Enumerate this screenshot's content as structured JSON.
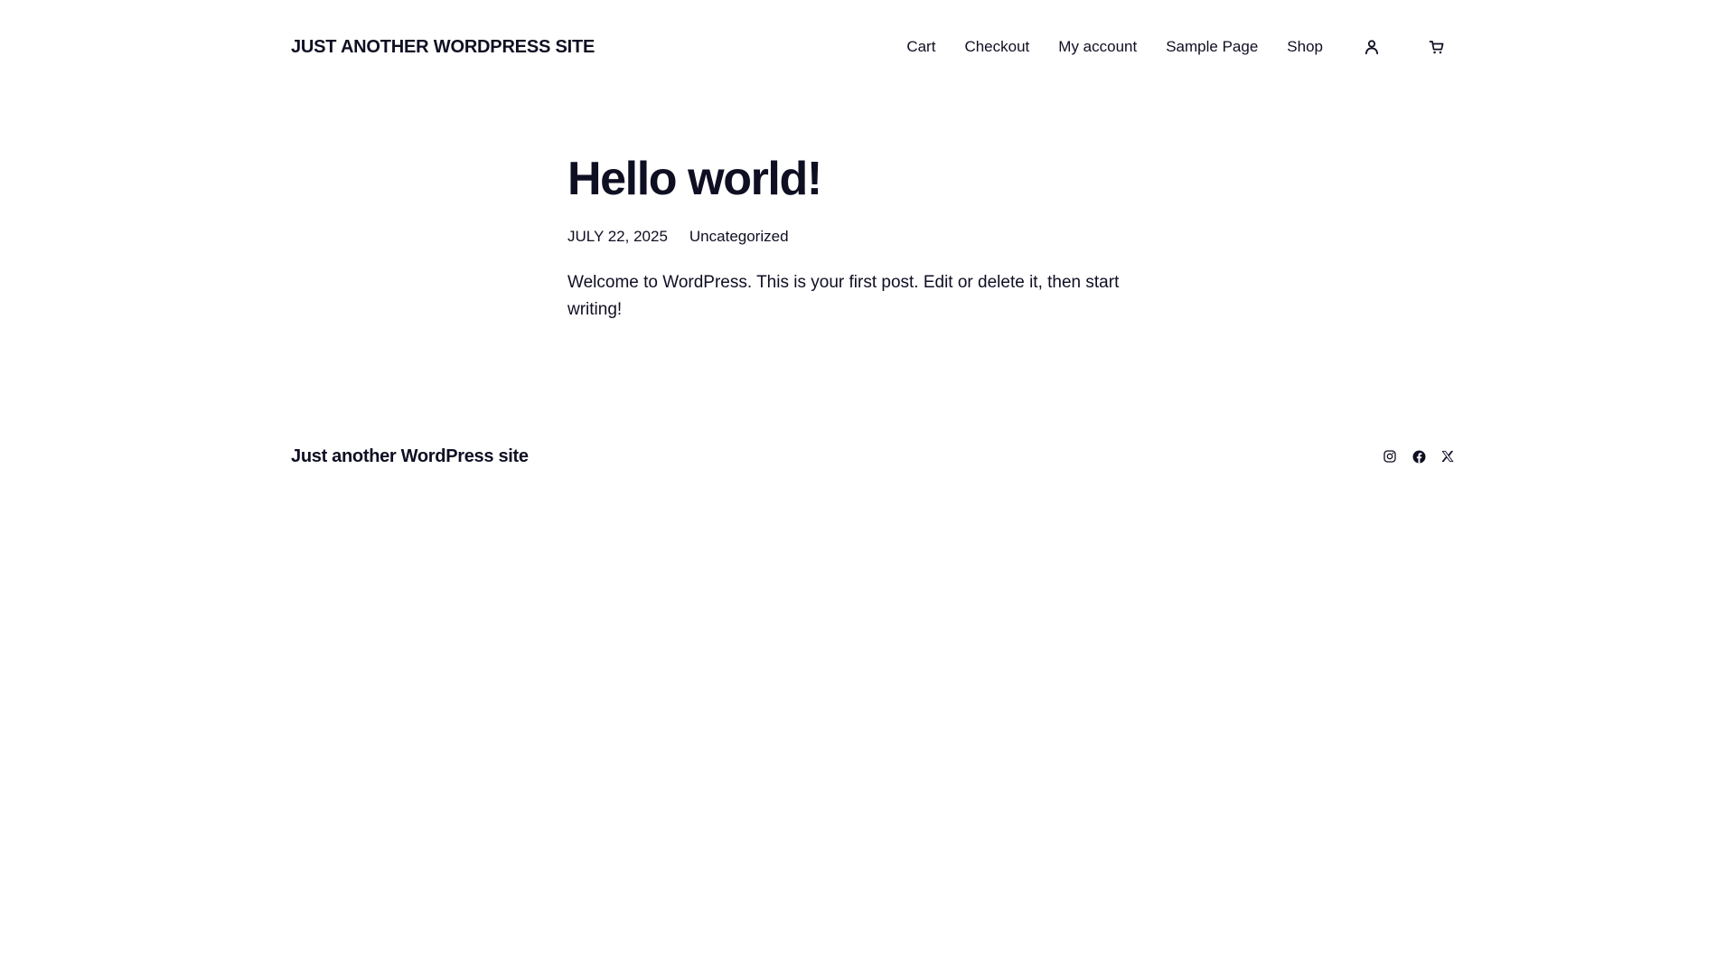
{
  "header": {
    "site_title": "JUST ANOTHER WORDPRESS SITE",
    "nav": [
      {
        "label": "Cart"
      },
      {
        "label": "Checkout"
      },
      {
        "label": "My account"
      },
      {
        "label": "Sample Page"
      },
      {
        "label": "Shop"
      }
    ],
    "account_icon": "user-icon",
    "cart_icon": "cart-icon"
  },
  "post": {
    "title": "Hello world!",
    "date": "JULY 22, 2025",
    "category": "Uncategorized",
    "content": "Welcome to WordPress. This is your first post. Edit or delete it, then start writing!"
  },
  "footer": {
    "site_title": "Just another WordPress site",
    "social": [
      {
        "icon": "instagram-icon"
      },
      {
        "icon": "facebook-icon"
      },
      {
        "icon": "x-icon"
      }
    ]
  },
  "colors": {
    "text": "#0f0f23",
    "background": "#ffffff"
  }
}
